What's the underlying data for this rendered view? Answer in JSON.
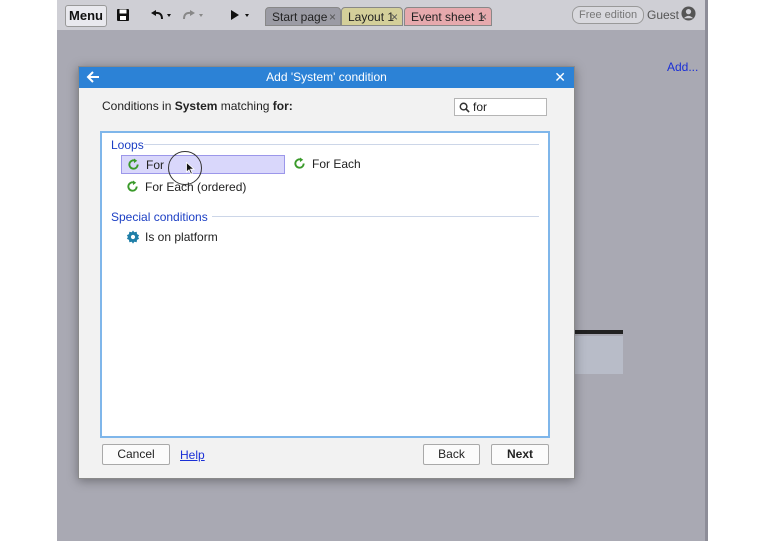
{
  "toolbar": {
    "menu_label": "Menu",
    "save_icon": "floppy-disk-icon",
    "undo_icon": "undo-icon",
    "redo_icon": "redo-icon",
    "play_icon": "play-icon",
    "tabs": [
      {
        "label": "Start page",
        "close": "×",
        "color": "#9b9ba4"
      },
      {
        "label": "Layout 1",
        "close": "×",
        "color": "#d4cf9a"
      },
      {
        "label": "Event sheet 1",
        "close": "×",
        "color": "#e6a9ad"
      }
    ],
    "edition_badge": "Free edition",
    "user_label": "Guest",
    "user_icon": "user-circle-icon"
  },
  "workspace": {
    "add_link": "Add..."
  },
  "dialog": {
    "title": "Add 'System' condition",
    "back_icon": "arrow-left-icon",
    "close_icon": "close-icon",
    "close_glyph": "✕",
    "header_prefix": "Conditions in ",
    "header_object": "System",
    "header_middle": " matching ",
    "header_term": "for:",
    "search": {
      "value": "for",
      "icon": "search-icon"
    },
    "groups": [
      {
        "label": "Loops",
        "items": [
          {
            "label": "For",
            "icon": "loop-icon",
            "selected": true
          },
          {
            "label": "For Each",
            "icon": "loop-icon",
            "selected": false
          },
          {
            "label": "For Each (ordered)",
            "icon": "loop-icon",
            "selected": false
          }
        ]
      },
      {
        "label": "Special conditions",
        "items": [
          {
            "label": "Is on platform",
            "icon": "gear-icon",
            "selected": false
          }
        ]
      }
    ],
    "buttons": {
      "cancel": "Cancel",
      "help": "Help",
      "back": "Back",
      "next": "Next"
    }
  },
  "colors": {
    "title_bar": "#2c82d6",
    "group_label": "#1c3fc4",
    "link": "#1a2fd6",
    "loop_icon": "#3a9a2a",
    "selected_bg": "#d9d7fb"
  }
}
